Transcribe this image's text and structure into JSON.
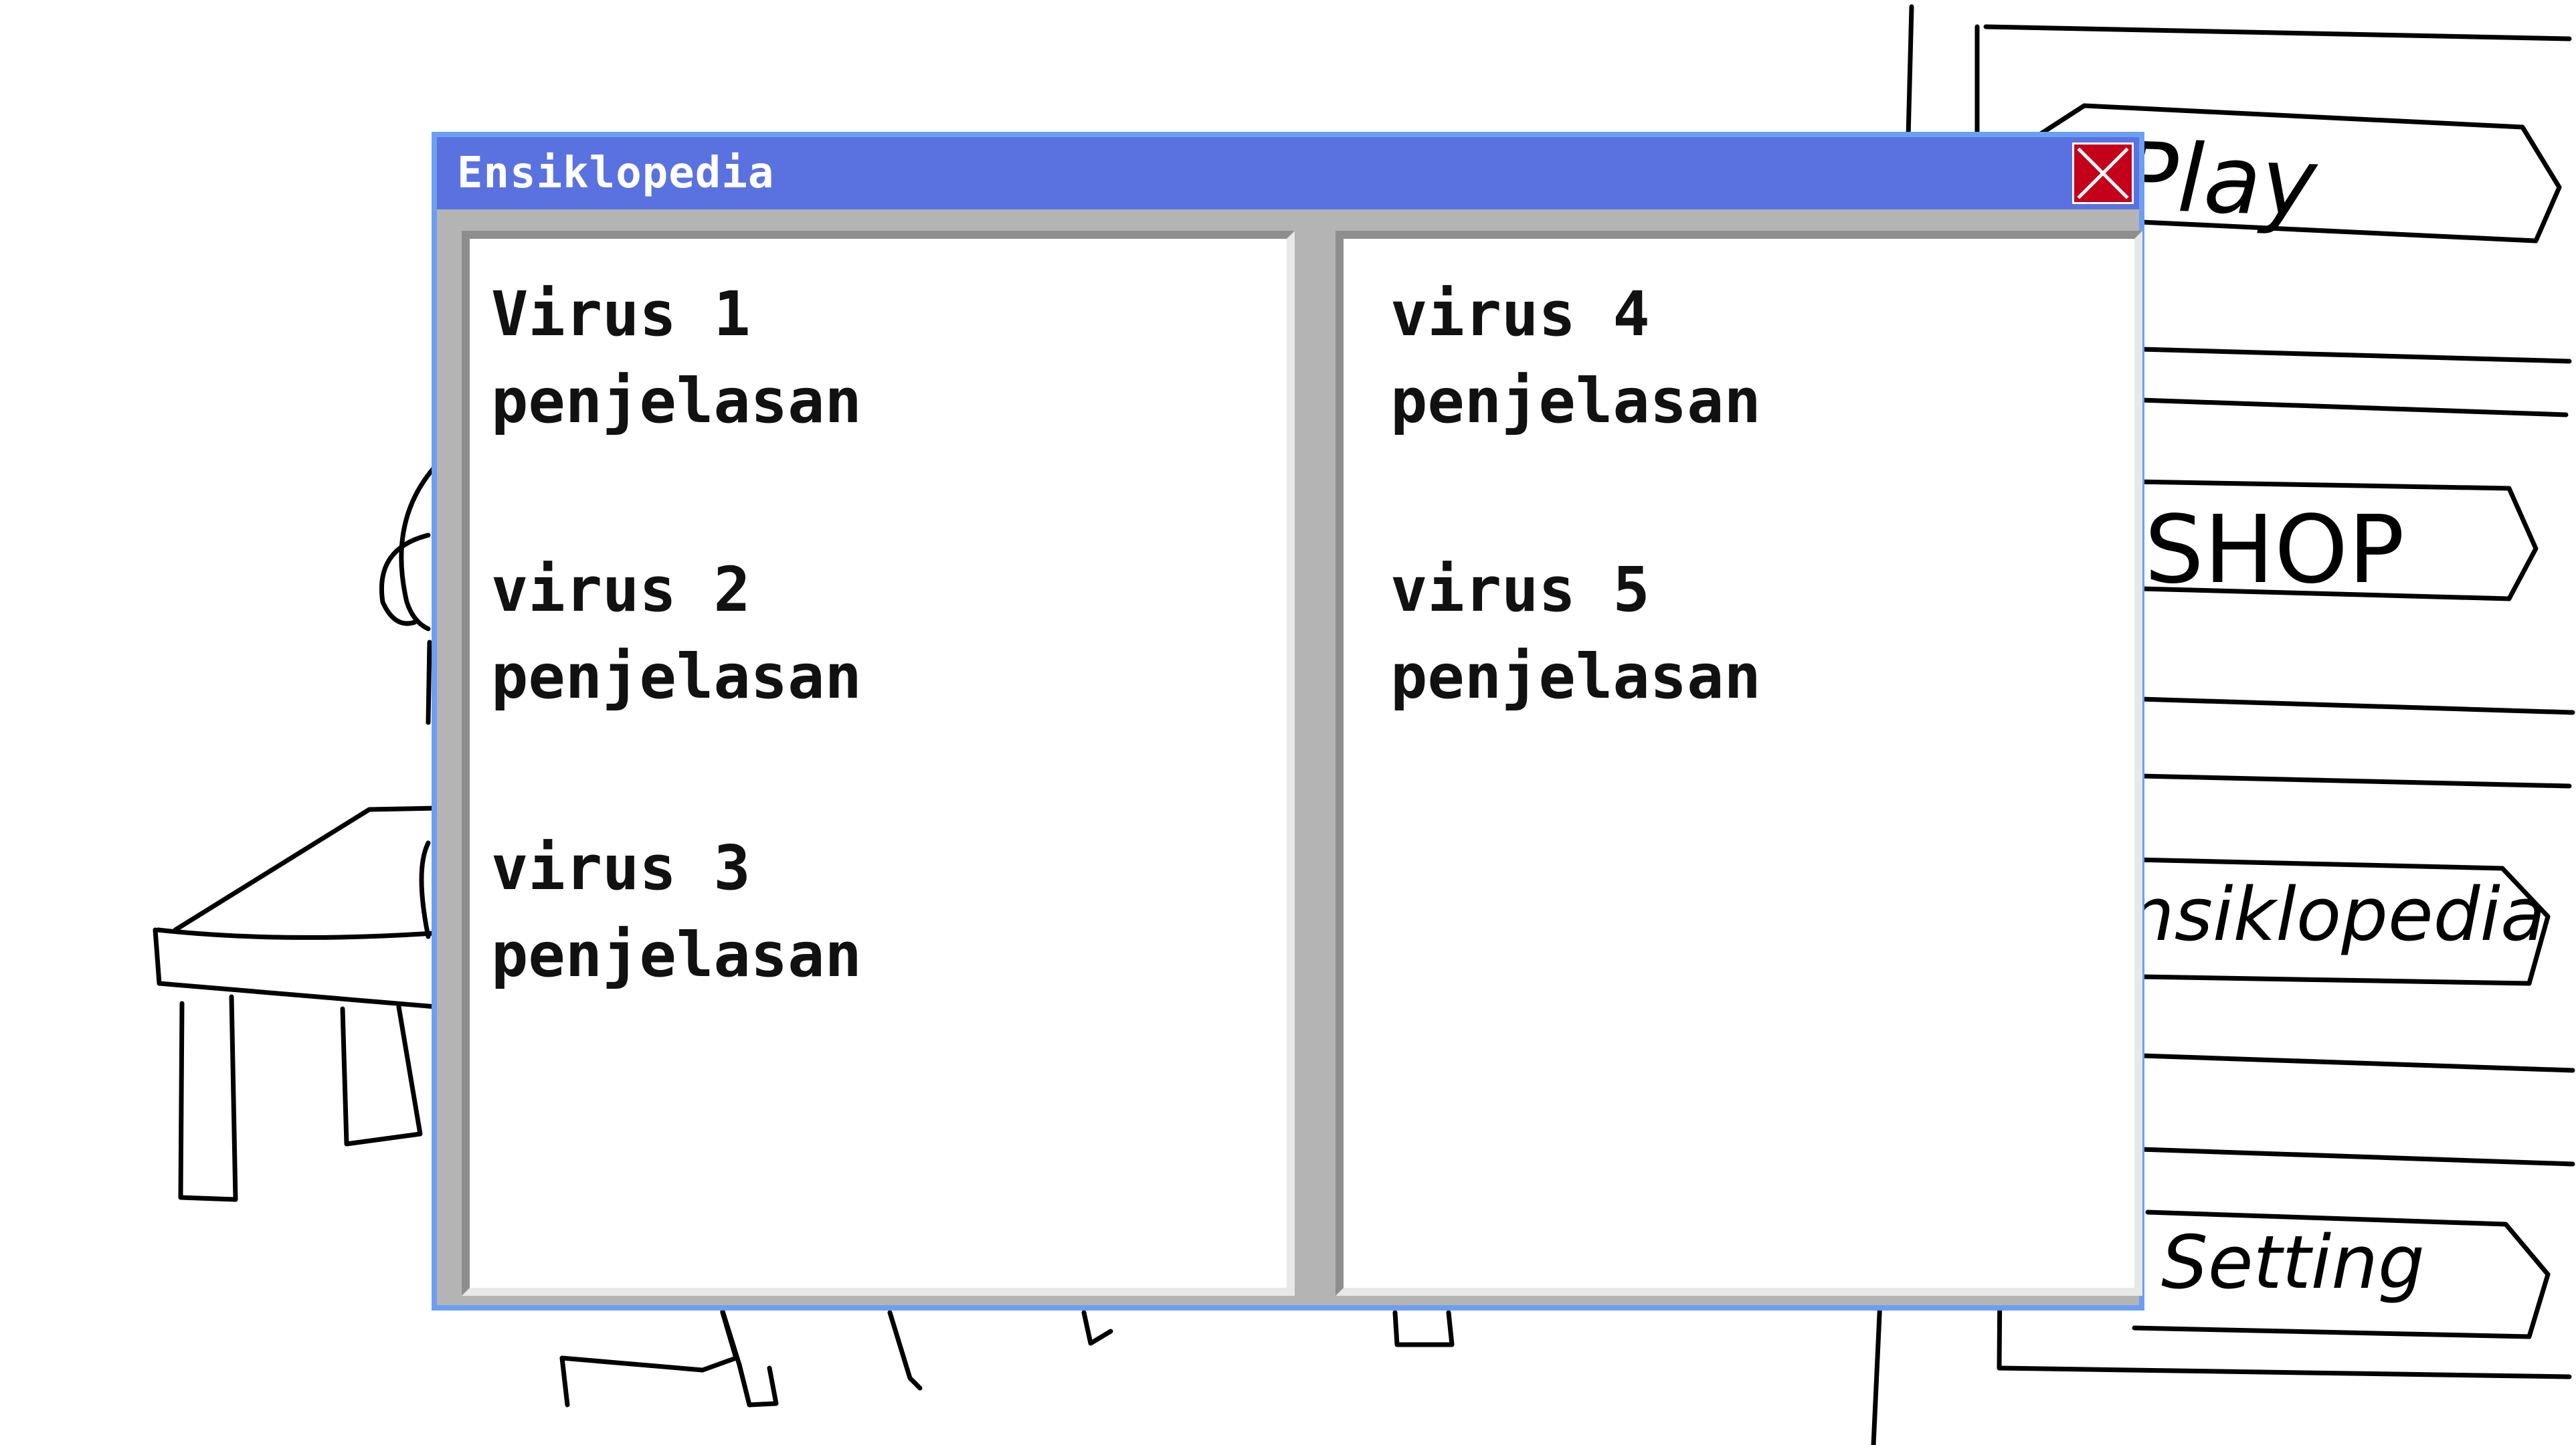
{
  "window": {
    "title": "Ensiklopedia",
    "close_icon": "close-x-icon"
  },
  "pages": {
    "left": [
      {
        "name": "Virus 1",
        "desc": "penjelasan"
      },
      {
        "name": "virus 2",
        "desc": "penjelasan"
      },
      {
        "name": "virus 3",
        "desc": "penjelasan"
      }
    ],
    "right": [
      {
        "name": "virus 4",
        "desc": "penjelasan"
      },
      {
        "name": "virus 5",
        "desc": "penjelasan"
      }
    ]
  },
  "background_menu": {
    "play": "Play",
    "shop": "SHOP",
    "ensiklopedia": "nsiklopedia",
    "setting": "Setting"
  },
  "colors": {
    "titlebar": "#5a72e0",
    "window_border": "#6b9ff2",
    "frame_gray": "#b4b4b4",
    "close_red": "#c4001a"
  }
}
